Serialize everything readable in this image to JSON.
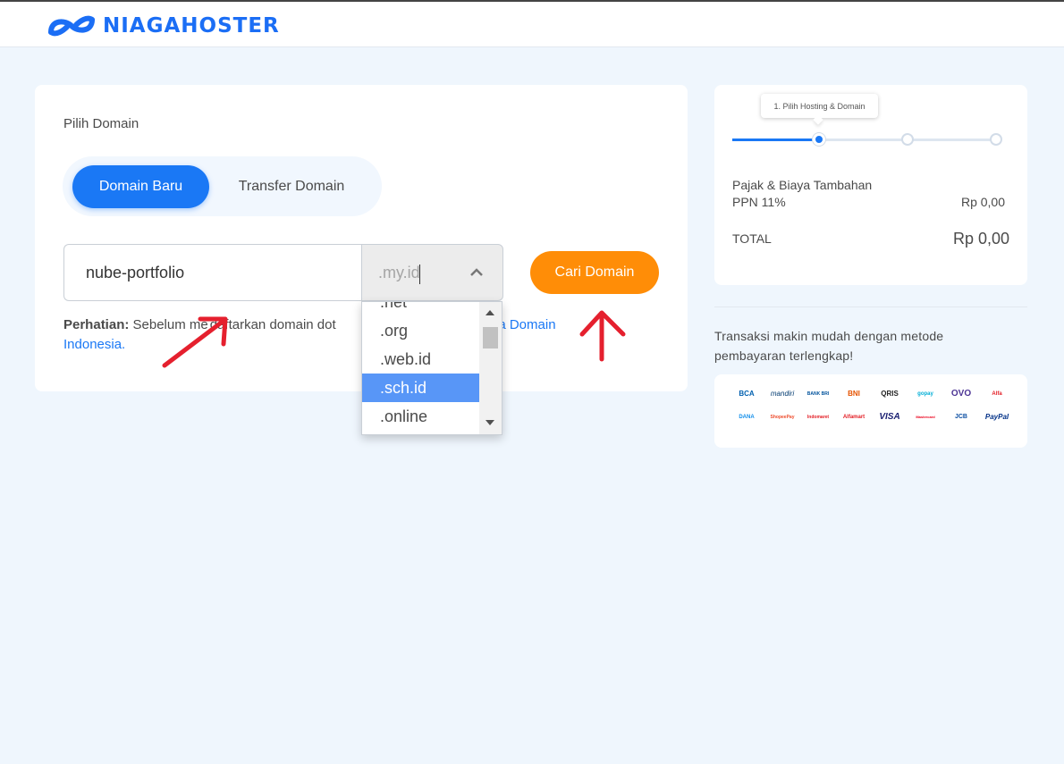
{
  "brand": {
    "name": "NIAGAHOSTER",
    "color": "#1b6ef5"
  },
  "domain_section": {
    "title": "Pilih Domain",
    "tabs": [
      {
        "label": "Domain Baru",
        "active": true
      },
      {
        "label": "Transfer Domain",
        "active": false
      }
    ],
    "domain_input_value": "nube-portfolio",
    "tld_selected": ".my.id",
    "search_button": "Cari Domain",
    "notice_label": "Perhatian:",
    "notice_text": " Sebelum me",
    "notice_text_2": "daftarkan domain dot",
    "notice_link": "Nama Domain",
    "notice_link_2": "Indonesia."
  },
  "tld_dropdown": {
    "options": [
      ".net",
      ".org",
      ".web.id",
      ".sch.id",
      ".online"
    ],
    "highlighted": ".sch.id"
  },
  "order_summary": {
    "step_tooltip": "1. Pilih Hosting & Domain",
    "steps_total": 3,
    "current_step": 1,
    "tax_heading": "Pajak & Biaya Tambahan",
    "tax_label": "PPN 11%",
    "tax_value": "Rp 0,00",
    "total_label": "TOTAL",
    "total_value": "Rp 0,00"
  },
  "payment": {
    "promo_text": "Transaksi makin mudah dengan metode pembayaran terlengkap!",
    "methods": [
      "BCA",
      "mandiri",
      "BANK BRI",
      "BNI",
      "QRIS",
      "gopay",
      "OVO",
      "Alfa",
      "DANA",
      "ShopeePay",
      "Indomaret",
      "Alfamart",
      "VISA",
      "Mastercard",
      "JCB",
      "PayPal"
    ]
  },
  "colors": {
    "primary": "#1a78f5",
    "accent": "#ff8d07",
    "background": "#eff6fd",
    "annotation": "#e5202e"
  }
}
